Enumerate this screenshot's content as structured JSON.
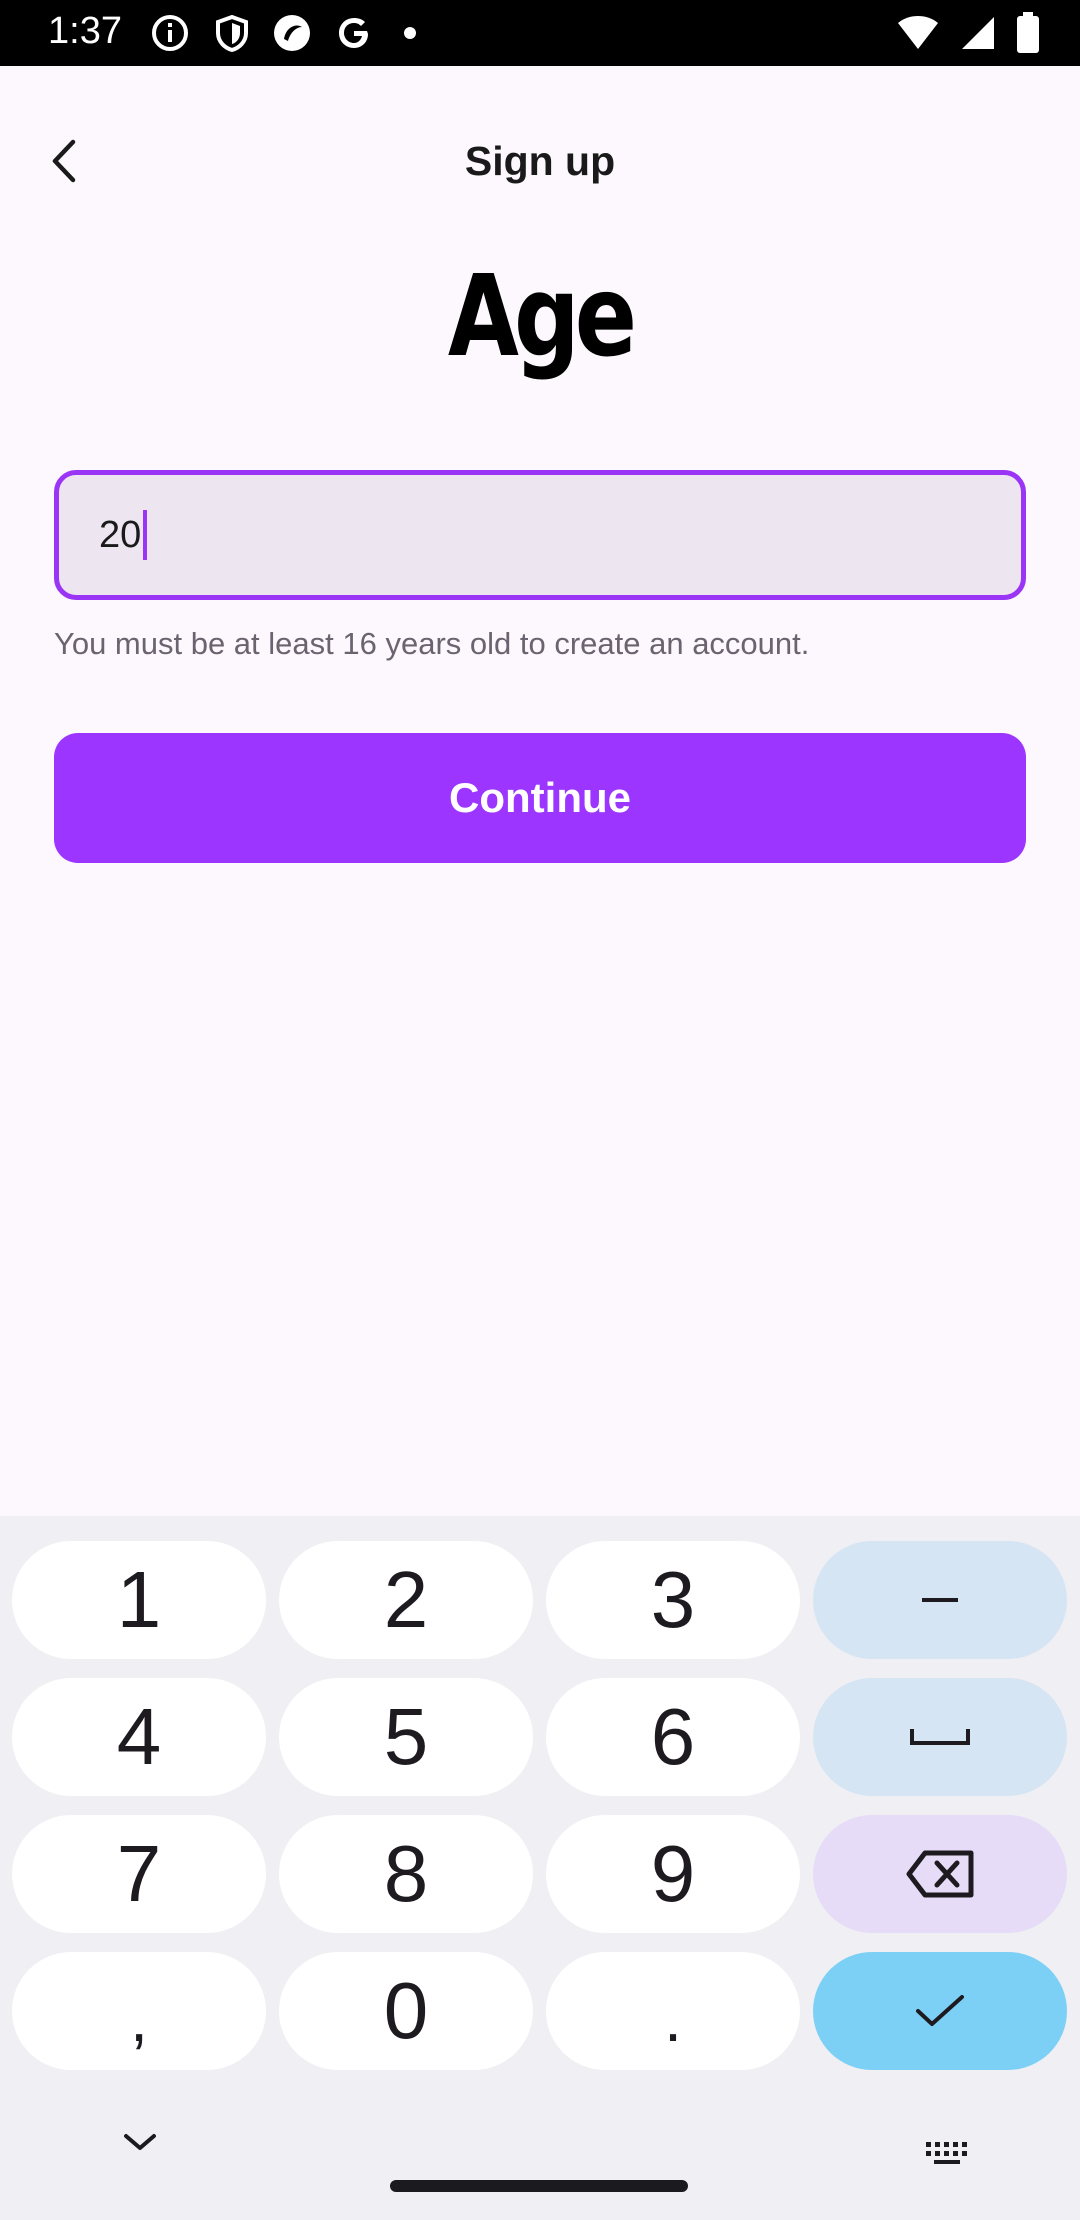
{
  "status_bar": {
    "time": "1:37",
    "icons": [
      "info-icon",
      "shield-icon",
      "app-icon",
      "google-icon",
      "dot-icon"
    ],
    "right_icons": [
      "wifi-icon",
      "signal-icon",
      "battery-icon"
    ]
  },
  "header": {
    "title": "Sign up",
    "back_icon": "chevron-left-icon"
  },
  "page": {
    "heading": "Age",
    "input_value": "20",
    "hint": "You must be at least 16 years old to create an account.",
    "continue_label": "Continue"
  },
  "keyboard": {
    "keys": [
      {
        "label": "1",
        "type": "digit"
      },
      {
        "label": "2",
        "type": "digit"
      },
      {
        "label": "3",
        "type": "digit"
      },
      {
        "label": "–",
        "type": "func",
        "name": "minus-key"
      },
      {
        "label": "4",
        "type": "digit"
      },
      {
        "label": "5",
        "type": "digit"
      },
      {
        "label": "6",
        "type": "digit"
      },
      {
        "label": "␣",
        "type": "func",
        "name": "space-key"
      },
      {
        "label": "7",
        "type": "digit"
      },
      {
        "label": "8",
        "type": "digit"
      },
      {
        "label": "9",
        "type": "digit"
      },
      {
        "label": "⌫",
        "type": "del",
        "name": "backspace-key"
      },
      {
        "label": ",",
        "type": "digit"
      },
      {
        "label": "0",
        "type": "digit"
      },
      {
        "label": ".",
        "type": "digit"
      },
      {
        "label": "✓",
        "type": "done",
        "name": "done-key"
      }
    ],
    "bottom_left_icon": "chevron-down-icon",
    "bottom_right_icon": "keyboard-icon"
  },
  "colors": {
    "accent": "#9b35ff",
    "background": "#fcf8fd",
    "input_bg": "#ede6f1"
  }
}
